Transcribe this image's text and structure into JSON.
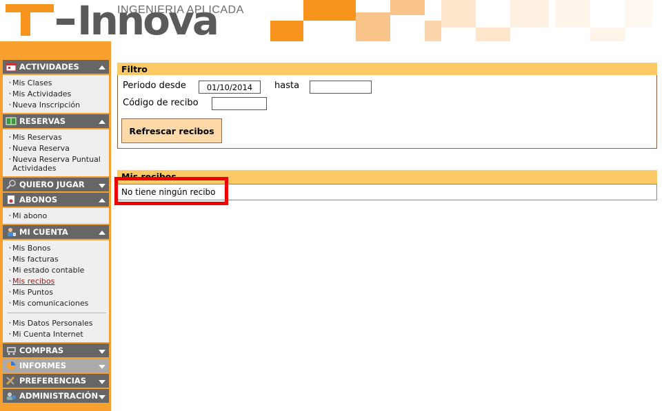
{
  "header": {
    "logo_text": "Innova",
    "logo_prefix": "T",
    "logo_tagline": "INGENIERIA APLICADA",
    "colors": {
      "orange": "#f7941e",
      "gray": "#5a5a5a"
    }
  },
  "sidebar": {
    "sections": [
      {
        "title": "ACTIVIDADES",
        "icon": "calendar-icon",
        "expanded": true,
        "items": [
          "Mis Clases",
          "Mis Actividades",
          "Nueva Inscripción"
        ]
      },
      {
        "title": "RESERVAS",
        "icon": "court-icon",
        "expanded": true,
        "items": [
          "Mis Reservas",
          "Nueva Reserva",
          "Nueva Reserva Puntual Actividades"
        ]
      },
      {
        "title": "QUIERO JUGAR",
        "icon": "racket-icon",
        "expanded": false,
        "items": []
      },
      {
        "title": "ABONOS",
        "icon": "card-icon",
        "expanded": true,
        "items": [
          "Mi abono"
        ]
      },
      {
        "title": "MI CUENTA",
        "icon": "user-icon",
        "expanded": true,
        "items": [
          "Mis Bonos",
          "Mis facturas",
          "Mi estado contable",
          "Mis recibos",
          "Mis Puntos",
          "Mis comunicaciones",
          "Mis Datos Personales",
          "Mi Cuenta Internet"
        ],
        "active_item": "Mis recibos"
      },
      {
        "title": "COMPRAS",
        "icon": "cart-icon",
        "expanded": false,
        "items": []
      },
      {
        "title": "INFORMES",
        "icon": "chart-icon",
        "expanded": false,
        "items": [],
        "disabled": true
      },
      {
        "title": "PREFERENCIAS",
        "icon": "tools-icon",
        "expanded": false,
        "items": []
      },
      {
        "title": "ADMINISTRACIÓN",
        "icon": "admin-icon",
        "expanded": false,
        "items": []
      }
    ]
  },
  "filter": {
    "title": "Filtro",
    "period_from_label": "Periodo desde",
    "period_from_value": "01/10/2014",
    "period_to_label": "hasta",
    "period_to_value": "",
    "receipt_code_label": "Código de recibo",
    "receipt_code_value": "",
    "refresh_button": "Refrescar recibos"
  },
  "receipts": {
    "title": "Mis recibos",
    "empty_message": "No tiene ningún recibo"
  }
}
